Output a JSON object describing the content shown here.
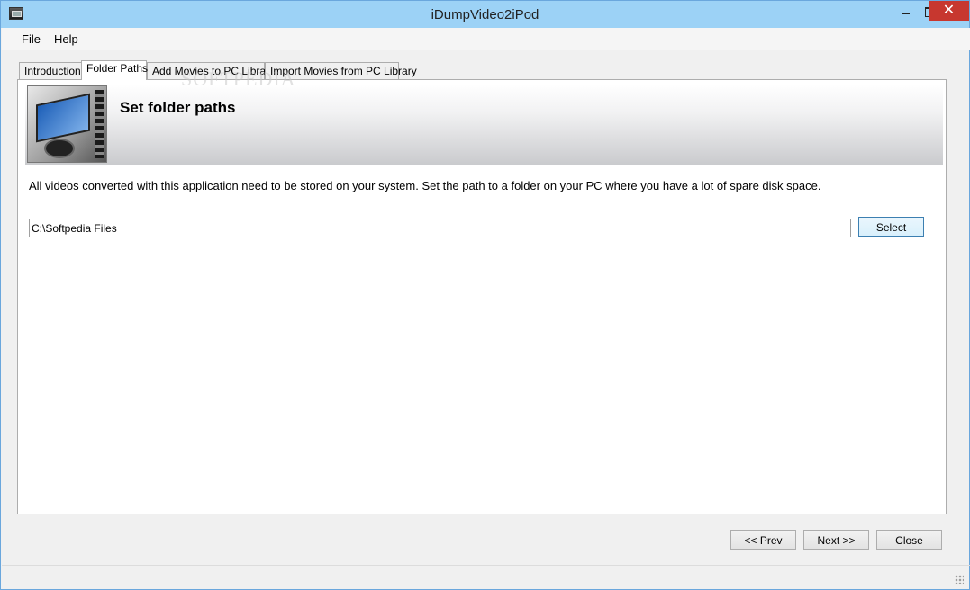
{
  "window": {
    "title": "iDumpVideo2iPod",
    "close_glyph": "✕"
  },
  "menu": {
    "items": [
      {
        "label": "File"
      },
      {
        "label": "Help"
      }
    ]
  },
  "tabs": [
    {
      "label": "Introduction",
      "active": false
    },
    {
      "label": "Folder Paths",
      "active": true
    },
    {
      "label": "Add Movies to PC Library",
      "active": false
    },
    {
      "label": "Import Movies from PC Library",
      "active": false
    }
  ],
  "banner": {
    "title": "Set folder paths",
    "image_icon": "ipod-video-icon"
  },
  "main": {
    "description": "All videos converted with this application need to be stored on your system.  Set the path to a folder on your PC where you have a lot of spare disk space.",
    "folder_path_value": "C:\\Softpedia Files",
    "select_label": "Select"
  },
  "footer": {
    "prev_label": "<< Prev",
    "next_label": "Next >>",
    "close_label": "Close"
  },
  "watermark": "SOFTPEDIA",
  "colors": {
    "titlebar": "#9cd2f6",
    "close_button": "#c7372f",
    "window_border": "#6aa7dd"
  }
}
